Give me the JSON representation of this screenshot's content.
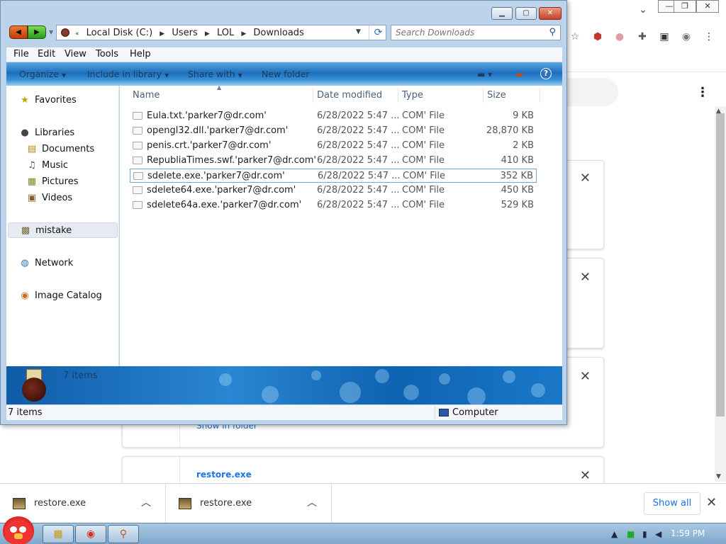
{
  "explorer": {
    "address": {
      "crumbs": [
        "Local Disk (C:)",
        "Users",
        "LOL",
        "Downloads"
      ]
    },
    "search_placeholder": "Search Downloads",
    "menu": [
      "File",
      "Edit",
      "View",
      "Tools",
      "Help"
    ],
    "commands": {
      "organize": "Organize",
      "include": "Include in library",
      "share": "Share with",
      "new_folder": "New folder"
    },
    "nav": {
      "favorites": "Favorites",
      "libraries": "Libraries",
      "documents": "Documents",
      "music": "Music",
      "pictures": "Pictures",
      "videos": "Videos",
      "mistake": "mistake",
      "network": "Network",
      "image_catalog": "Image Catalog"
    },
    "columns": {
      "name": "Name",
      "date": "Date modified",
      "type": "Type",
      "size": "Size"
    },
    "files": [
      {
        "name": "Eula.txt.'parker7@dr.com'",
        "date": "6/28/2022 5:47 ...",
        "type": "COM' File",
        "size": "9 KB"
      },
      {
        "name": "opengl32.dll.'parker7@dr.com'",
        "date": "6/28/2022 5:47 ...",
        "type": "COM' File",
        "size": "28,870 KB"
      },
      {
        "name": "penis.crt.'parker7@dr.com'",
        "date": "6/28/2022 5:47 ...",
        "type": "COM' File",
        "size": "2 KB"
      },
      {
        "name": "RepubliaTimes.swf.'parker7@dr.com'",
        "date": "6/28/2022 5:47 ...",
        "type": "COM' File",
        "size": "410 KB"
      },
      {
        "name": "sdelete.exe.'parker7@dr.com'",
        "date": "6/28/2022 5:47 ...",
        "type": "COM' File",
        "size": "352 KB"
      },
      {
        "name": "sdelete64.exe.'parker7@dr.com'",
        "date": "6/28/2022 5:47 ...",
        "type": "COM' File",
        "size": "450 KB"
      },
      {
        "name": "sdelete64a.exe.'parker7@dr.com'",
        "date": "6/28/2022 5:47 ...",
        "type": "COM' File",
        "size": "529 KB"
      }
    ],
    "details_count": "7 items",
    "status_count": "7 items",
    "status_location": "Computer"
  },
  "browser": {
    "card_link": "Show in folder",
    "card_name": "restore.exe",
    "shelf_items": [
      "restore.exe",
      "restore.exe"
    ],
    "show_all": "Show all"
  },
  "taskbar": {
    "clock": "1:59 PM"
  },
  "colors": {
    "accent_blue": "#1a73e8",
    "cmdbar_blue": "#1d6fbe",
    "selection_border": "#7da2ce"
  }
}
